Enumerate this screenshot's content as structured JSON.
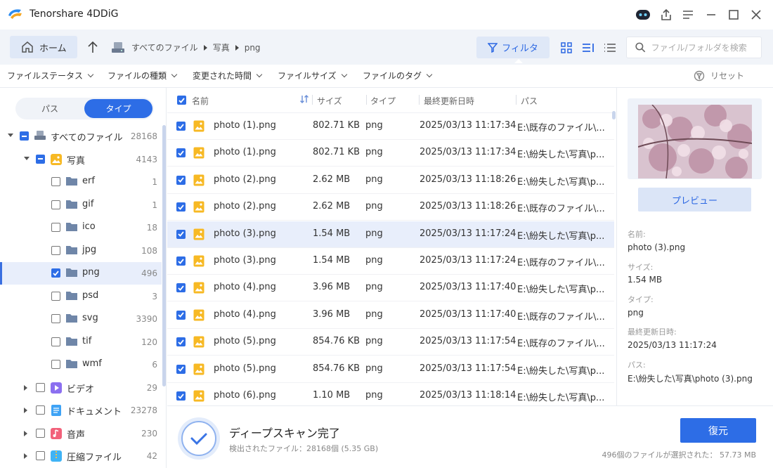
{
  "app": {
    "title": "Tenorshare 4DDiG"
  },
  "toolbar": {
    "home_label": "ホーム",
    "breadcrumb": [
      "すべてのファイル",
      "写真",
      "png"
    ],
    "filter_label": "フィルタ",
    "search_placeholder": "ファイル/フォルダを検索"
  },
  "filterbar": {
    "dropdowns": [
      "ファイルステータス",
      "ファイルの種類",
      "変更された時間",
      "ファイルサイズ",
      "ファイルのタグ"
    ],
    "reset_label": "リセット"
  },
  "sidebar": {
    "toggle": {
      "path": "パス",
      "type": "タイプ",
      "active": "type"
    },
    "tree": [
      {
        "label": "すべてのファイル",
        "count": "28168",
        "level": 0,
        "expanded": true,
        "check": "partial",
        "icon": "drive-icon"
      },
      {
        "label": "写真",
        "count": "4143",
        "level": 1,
        "expanded": true,
        "check": "partial",
        "icon": "photo-category-icon"
      },
      {
        "label": "erf",
        "count": "1",
        "level": 2,
        "check": "none",
        "icon": "folder-icon"
      },
      {
        "label": "gif",
        "count": "1",
        "level": 2,
        "check": "none",
        "icon": "folder-icon"
      },
      {
        "label": "ico",
        "count": "18",
        "level": 2,
        "check": "none",
        "icon": "folder-icon"
      },
      {
        "label": "jpg",
        "count": "108",
        "level": 2,
        "check": "none",
        "icon": "folder-icon"
      },
      {
        "label": "png",
        "count": "496",
        "level": 2,
        "check": "checked",
        "icon": "folder-icon",
        "selected": true
      },
      {
        "label": "psd",
        "count": "3",
        "level": 2,
        "check": "none",
        "icon": "folder-icon"
      },
      {
        "label": "svg",
        "count": "3390",
        "level": 2,
        "check": "none",
        "icon": "folder-icon"
      },
      {
        "label": "tif",
        "count": "120",
        "level": 2,
        "check": "none",
        "icon": "folder-icon"
      },
      {
        "label": "wmf",
        "count": "6",
        "level": 2,
        "check": "none",
        "icon": "folder-icon"
      },
      {
        "label": "ビデオ",
        "count": "29",
        "level": 1,
        "expanded": false,
        "check": "none",
        "icon": "video-category-icon"
      },
      {
        "label": "ドキュメント",
        "count": "23278",
        "level": 1,
        "expanded": false,
        "check": "none",
        "icon": "document-category-icon"
      },
      {
        "label": "音声",
        "count": "230",
        "level": 1,
        "expanded": false,
        "check": "none",
        "icon": "audio-category-icon"
      },
      {
        "label": "圧縮ファイル",
        "count": "42",
        "level": 1,
        "expanded": false,
        "check": "none",
        "icon": "archive-category-icon"
      }
    ]
  },
  "table": {
    "headers": {
      "name": "名前",
      "size": "サイズ",
      "type": "タイプ",
      "modified": "最終更新日時",
      "path": "パス"
    },
    "rows": [
      {
        "name": "photo (1).png",
        "size": "802.71 KB",
        "type": "png",
        "modified": "2025/03/13 11:17:34",
        "path": "E:\\既存のファイル\\..."
      },
      {
        "name": "photo (1).png",
        "size": "802.71 KB",
        "type": "png",
        "modified": "2025/03/13 11:17:34",
        "path": "E:\\紛失した\\写真\\p..."
      },
      {
        "name": "photo (2).png",
        "size": "2.62 MB",
        "type": "png",
        "modified": "2025/03/13 11:18:26",
        "path": "E:\\紛失した\\写真\\p..."
      },
      {
        "name": "photo (2).png",
        "size": "2.62 MB",
        "type": "png",
        "modified": "2025/03/13 11:18:26",
        "path": "E:\\既存のファイル\\..."
      },
      {
        "name": "photo (3).png",
        "size": "1.54 MB",
        "type": "png",
        "modified": "2025/03/13 11:17:24",
        "path": "E:\\紛失した\\写真\\p...",
        "selected": true
      },
      {
        "name": "photo (3).png",
        "size": "1.54 MB",
        "type": "png",
        "modified": "2025/03/13 11:17:24",
        "path": "E:\\既存のファイル\\..."
      },
      {
        "name": "photo (4).png",
        "size": "3.96 MB",
        "type": "png",
        "modified": "2025/03/13 11:17:40",
        "path": "E:\\紛失した\\写真\\p..."
      },
      {
        "name": "photo (4).png",
        "size": "3.96 MB",
        "type": "png",
        "modified": "2025/03/13 11:17:40",
        "path": "E:\\既存のファイル\\..."
      },
      {
        "name": "photo (5).png",
        "size": "854.76 KB",
        "type": "png",
        "modified": "2025/03/13 11:17:54",
        "path": "E:\\既存のファイル\\..."
      },
      {
        "name": "photo (5).png",
        "size": "854.76 KB",
        "type": "png",
        "modified": "2025/03/13 11:17:54",
        "path": "E:\\紛失した\\写真\\p..."
      },
      {
        "name": "photo (6).png",
        "size": "1.10 MB",
        "type": "png",
        "modified": "2025/03/13 11:18:14",
        "path": "E:\\紛失した\\写真\\p..."
      }
    ]
  },
  "details": {
    "preview_label": "プレビュー",
    "name_label": "名前:",
    "name_value": "photo (3).png",
    "size_label": "サイズ:",
    "size_value": "1.54 MB",
    "type_label": "タイプ:",
    "type_value": "png",
    "modified_label": "最終更新日時:",
    "modified_value": "2025/03/13 11:17:24",
    "path_label": "パス:",
    "path_value": "E:\\紛失した\\写真\\photo (3).png"
  },
  "status": {
    "title": "ディープスキャン完了",
    "detail": "検出されたファイル：28168個 (5.35 GB)",
    "recover_label": "復元",
    "selection": "496個のファイルが選択された： 57.73 MB"
  },
  "colors": {
    "accent": "#2d6de6",
    "selection": "#e8eefb",
    "toolbar": "#f1f4f9"
  }
}
